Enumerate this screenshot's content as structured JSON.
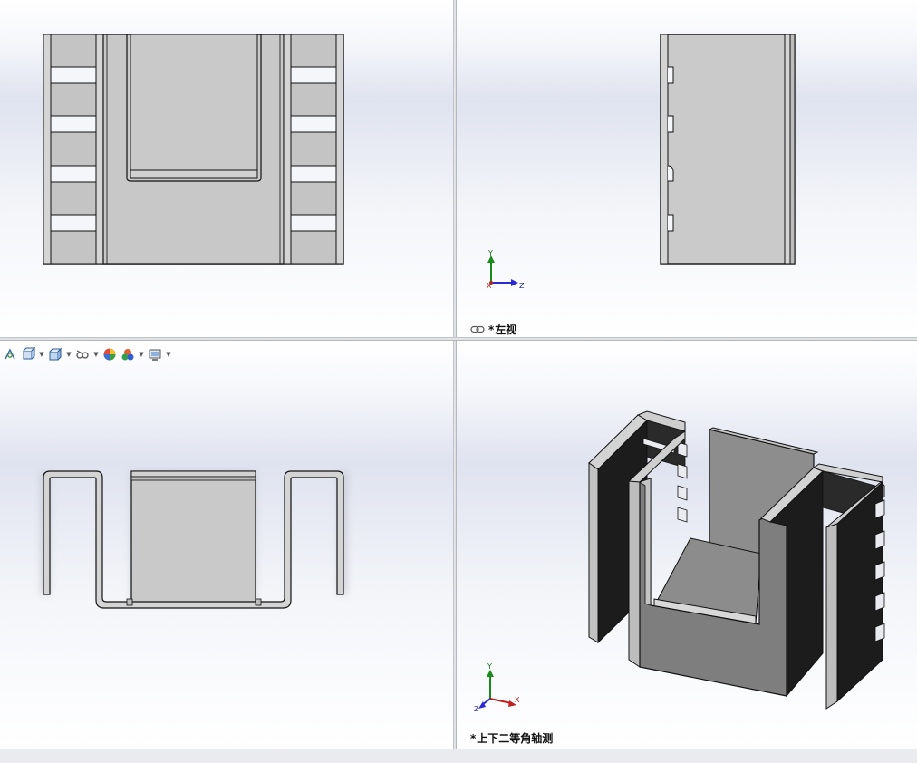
{
  "viewports": {
    "top_left": {
      "label": ""
    },
    "top_right": {
      "label_prefix": "*",
      "label": "左视"
    },
    "bottom_left": {
      "label": ""
    },
    "bottom_right": {
      "label_prefix": "*",
      "label": "上下二等角轴测"
    }
  },
  "triad": {
    "y": "Y",
    "z": "Z",
    "x": "X"
  },
  "toolbar": {
    "items": [
      "view-orientation-icon",
      "section-view-icon",
      "display-style-icon",
      "hide-show-icon",
      "edit-appearance-icon",
      "apply-scene-icon",
      "view-settings-icon"
    ]
  },
  "colors": {
    "part_face": "#c8c8c8",
    "part_dark": "#1c1c1c",
    "part_mid": "#7f7f7f",
    "outline": "#111111"
  }
}
